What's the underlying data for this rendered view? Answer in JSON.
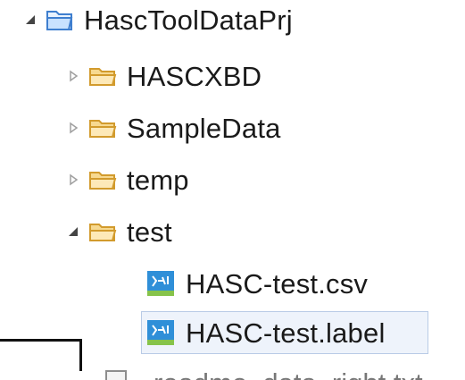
{
  "explorer": {
    "root": {
      "label": "HascToolDataPrj",
      "expanded": true
    },
    "folders": [
      {
        "label": "HASCXBD",
        "expanded": false
      },
      {
        "label": "SampleData",
        "expanded": false
      },
      {
        "label": "temp",
        "expanded": false
      },
      {
        "label": "test",
        "expanded": true
      }
    ],
    "files": [
      {
        "label": "HASC-test.csv",
        "selected": false
      },
      {
        "label": "HASC-test.label",
        "selected": true
      }
    ],
    "partial_item": {
      "label": "readme_data_right.txt"
    }
  }
}
